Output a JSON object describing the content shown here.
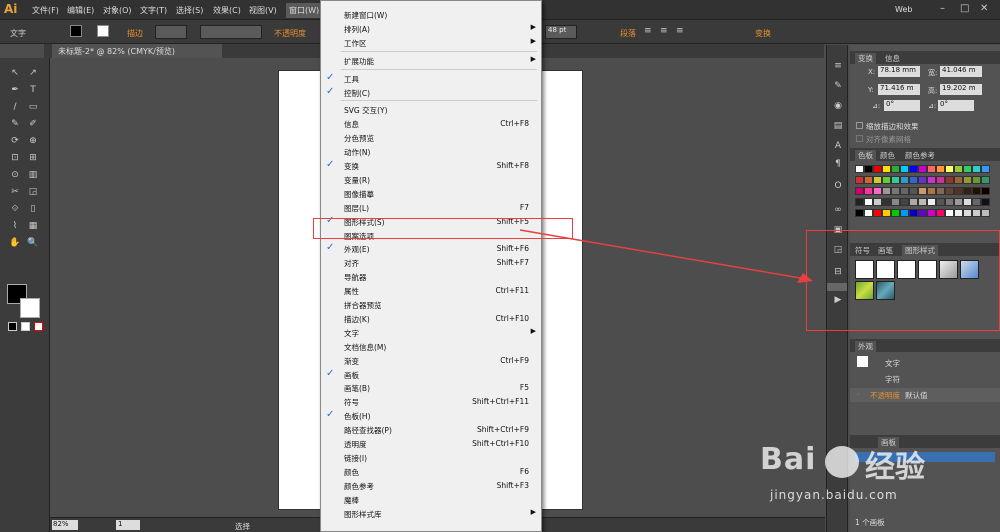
{
  "app": {
    "logo": "Ai",
    "workspace": "Web"
  },
  "menubar": [
    "文件(F)",
    "编辑(E)",
    "对象(O)",
    "文字(T)",
    "选择(S)",
    "效果(C)",
    "视图(V)",
    "窗口(W)"
  ],
  "control_bar": {
    "label": "文字",
    "stroke_label": "描边",
    "opacity_label": "不透明度",
    "font_size": "48 pt",
    "para_label": "段落",
    "transform_label": "变换"
  },
  "document_tab": "未标题-2* @ 82% (CMYK/预览)",
  "status": {
    "zoom": "82%",
    "page": "1",
    "mode": "选择"
  },
  "window_menu": [
    {
      "label": "新建窗口(W)",
      "shortcut": "",
      "checked": false,
      "submenu": false
    },
    {
      "label": "排列(A)",
      "shortcut": "",
      "checked": false,
      "submenu": true
    },
    {
      "label": "工作区",
      "shortcut": "",
      "checked": false,
      "submenu": true
    },
    {
      "label": "扩展功能",
      "shortcut": "",
      "checked": false,
      "submenu": true
    },
    {
      "label": "工具",
      "shortcut": "",
      "checked": true,
      "submenu": false
    },
    {
      "label": "控制(C)",
      "shortcut": "",
      "checked": true,
      "submenu": false
    },
    {
      "label": "SVG 交互(Y)",
      "shortcut": "",
      "checked": false,
      "submenu": false
    },
    {
      "label": "信息",
      "shortcut": "Ctrl+F8",
      "checked": false,
      "submenu": false
    },
    {
      "label": "分色预览",
      "shortcut": "",
      "checked": false,
      "submenu": false
    },
    {
      "label": "动作(N)",
      "shortcut": "",
      "checked": false,
      "submenu": false
    },
    {
      "label": "变换",
      "shortcut": "Shift+F8",
      "checked": true,
      "submenu": false
    },
    {
      "label": "变量(R)",
      "shortcut": "",
      "checked": false,
      "submenu": false
    },
    {
      "label": "图像描摹",
      "shortcut": "",
      "checked": false,
      "submenu": false
    },
    {
      "label": "图层(L)",
      "shortcut": "F7",
      "checked": false,
      "submenu": false
    },
    {
      "label": "图形样式(S)",
      "shortcut": "Shift+F5",
      "checked": true,
      "submenu": false
    },
    {
      "label": "图案选项",
      "shortcut": "",
      "checked": false,
      "submenu": false
    },
    {
      "label": "外观(E)",
      "shortcut": "Shift+F6",
      "checked": true,
      "submenu": false
    },
    {
      "label": "对齐",
      "shortcut": "Shift+F7",
      "checked": false,
      "submenu": false
    },
    {
      "label": "导航器",
      "shortcut": "",
      "checked": false,
      "submenu": false
    },
    {
      "label": "属性",
      "shortcut": "Ctrl+F11",
      "checked": false,
      "submenu": false
    },
    {
      "label": "拼合器预览",
      "shortcut": "",
      "checked": false,
      "submenu": false
    },
    {
      "label": "描边(K)",
      "shortcut": "Ctrl+F10",
      "checked": false,
      "submenu": false
    },
    {
      "label": "文字",
      "shortcut": "",
      "checked": false,
      "submenu": true
    },
    {
      "label": "文档信息(M)",
      "shortcut": "",
      "checked": false,
      "submenu": false
    },
    {
      "label": "渐变",
      "shortcut": "Ctrl+F9",
      "checked": false,
      "submenu": false
    },
    {
      "label": "画板",
      "shortcut": "",
      "checked": true,
      "submenu": false
    },
    {
      "label": "画笔(B)",
      "shortcut": "F5",
      "checked": false,
      "submenu": false
    },
    {
      "label": "符号",
      "shortcut": "Shift+Ctrl+F11",
      "checked": false,
      "submenu": false
    },
    {
      "label": "色板(H)",
      "shortcut": "",
      "checked": true,
      "submenu": false
    },
    {
      "label": "路径查找器(P)",
      "shortcut": "Shift+Ctrl+F9",
      "checked": false,
      "submenu": false
    },
    {
      "label": "透明度",
      "shortcut": "Shift+Ctrl+F10",
      "checked": false,
      "submenu": false
    },
    {
      "label": "链接(I)",
      "shortcut": "",
      "checked": false,
      "submenu": false
    },
    {
      "label": "颜色",
      "shortcut": "F6",
      "checked": false,
      "submenu": false
    },
    {
      "label": "颜色参考",
      "shortcut": "Shift+F3",
      "checked": false,
      "submenu": false
    },
    {
      "label": "魔棒",
      "shortcut": "",
      "checked": false,
      "submenu": false
    },
    {
      "label": "图形样式库",
      "shortcut": "",
      "checked": false,
      "submenu": true
    }
  ],
  "transform_panel": {
    "tabs": [
      "变换",
      "信息"
    ],
    "x": "78.18 mm",
    "w": "41.046 m",
    "y": "71.416 m",
    "h": "19.202 m",
    "angle": "0°",
    "shear": "0°",
    "opt1": "缩放描边和效果",
    "opt2": "对齐像素网格"
  },
  "swatch_panel": {
    "tabs": [
      "色板",
      "颜色",
      "颜色参考"
    ]
  },
  "styles_panel": {
    "tabs": [
      "符号",
      "画笔",
      "图形样式"
    ]
  },
  "appearance_panel": {
    "title": "外观",
    "items": [
      "文字",
      "字符",
      "不透明度",
      "默认值"
    ]
  },
  "artboard_panel": {
    "title": "画板",
    "count": "1 个画板"
  },
  "watermark": {
    "line1": "Bai",
    "line2": "经验",
    "line3": "jingyan.baidu.com"
  },
  "colors": {
    "accent": "#e89030",
    "check": "#2b72c8",
    "highlight": "#e84040"
  }
}
